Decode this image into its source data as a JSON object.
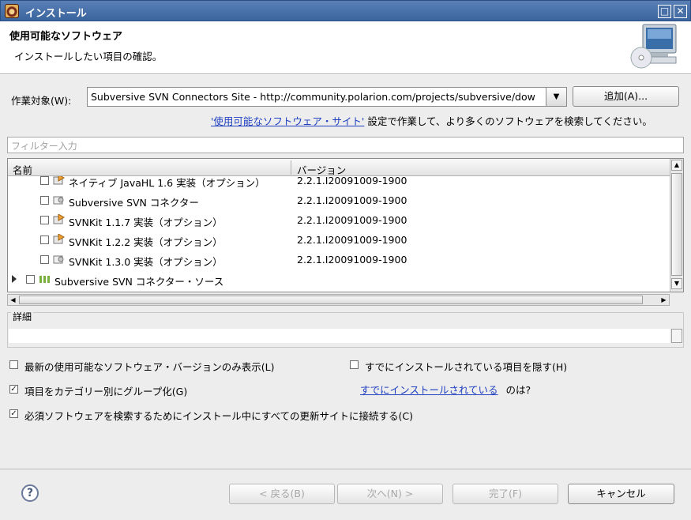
{
  "window": {
    "title": "インストール"
  },
  "header": {
    "title": "使用可能なソフトウェア",
    "subtitle": "インストールしたい項目の確認。"
  },
  "work_with": {
    "label": "作業対象(W):",
    "value": "Subversive SVN Connectors Site - http://community.polarion.com/projects/subversive/dow",
    "add_button": "追加(A)..."
  },
  "sites_info": {
    "link": "'使用可能なソフトウェア・サイト'",
    "text": "設定で作業して、より多くのソフトウェアを検索してください。"
  },
  "filter": {
    "placeholder": "フィルター入力"
  },
  "tree": {
    "columns": {
      "name": "名前",
      "version": "バージョン"
    },
    "rows": [
      {
        "name": "ネイティブ JavaHL 1.6 実装（オプション）",
        "version": "2.2.1.I20091009-1900",
        "icon": "plugin-orange-icon"
      },
      {
        "name": "Subversive SVN コネクター",
        "version": "2.2.1.I20091009-1900",
        "icon": "plugin-gray-icon"
      },
      {
        "name": "SVNKit 1.1.7 実装（オプション）",
        "version": "2.2.1.I20091009-1900",
        "icon": "plugin-orange-icon"
      },
      {
        "name": "SVNKit 1.2.2 実装（オプション）",
        "version": "2.2.1.I20091009-1900",
        "icon": "plugin-orange-icon"
      },
      {
        "name": "SVNKit 1.3.0 実装（オプション）",
        "version": "2.2.1.I20091009-1900",
        "icon": "plugin-gray-icon"
      },
      {
        "name": "Subversive SVN コネクター・ソース",
        "version": "",
        "icon": "category-icon"
      }
    ]
  },
  "details": {
    "label": "詳細"
  },
  "options": {
    "latest_only": {
      "label": "最新の使用可能なソフトウェア・バージョンのみ表示(L)",
      "checked": false
    },
    "hide_installed": {
      "label": "すでにインストールされている項目を隠す(H)",
      "checked": false
    },
    "group_by_category": {
      "label": "項目をカテゴリー別にグループ化(G)",
      "checked": true
    },
    "installed_link": "すでにインストールされている",
    "installed_suffix": "のは?",
    "contact_sites": {
      "label": "必須ソフトウェアを検索するためにインストール中にすべての更新サイトに接続する(C)",
      "checked": true
    }
  },
  "footer": {
    "help": "?",
    "back": "< 戻る(B)",
    "next": "次へ(N) >",
    "finish": "完了(F)",
    "cancel": "キャンセル"
  }
}
